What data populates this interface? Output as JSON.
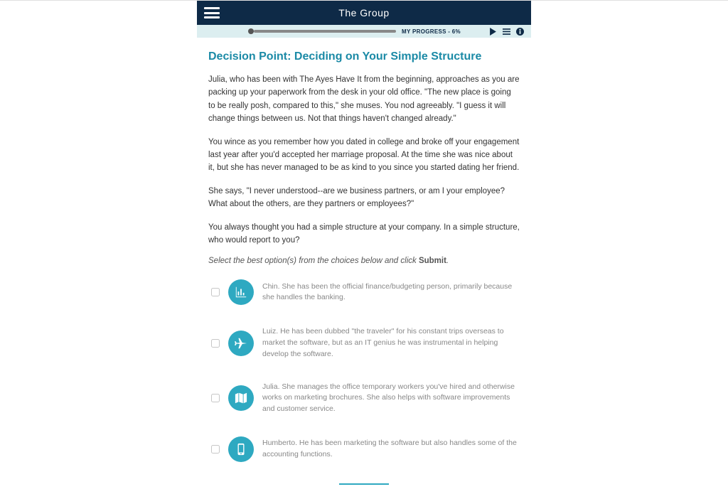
{
  "header": {
    "title": "The Group"
  },
  "progress": {
    "label": "MY PROGRESS - 6%"
  },
  "content": {
    "title": "Decision Point: Deciding on Your Simple Structure",
    "para1": "Julia, who has been with The Ayes Have It from the beginning, approaches as you are packing up your paperwork from the desk in your old office. \"The new place is going to be really posh, compared to this,\" she muses. You nod agreeably. \"I guess it will change things between us. Not that things haven't changed already.\"",
    "para2": "You wince as you remember how you dated in college and broke off your engagement last year after you'd accepted her marriage proposal. At the time she was nice about it, but she has never managed to be as kind to you since you started dating her friend.",
    "para3": "She says, \"I never understood--are we business partners, or am I your employee? What about the others, are they partners or employees?\"",
    "para4": "You always thought you had a simple structure at your company. In a simple structure, who would report to you?",
    "instruction_prefix": "Select the best option(s) from the choices below and click ",
    "instruction_bold": "Submit",
    "instruction_suffix": "."
  },
  "options": [
    {
      "icon": "bar-chart-icon",
      "text": "Chin. She has been the official finance/budgeting person, primarily because she handles the banking."
    },
    {
      "icon": "plane-icon",
      "text": "Luiz. He has been dubbed \"the traveler\" for his constant trips overseas to market the software, but as an IT genius he was instrumental in helping develop the software."
    },
    {
      "icon": "map-icon",
      "text": "Julia. She manages the office temporary workers you've hired and otherwise works on marketing brochures. She also helps with software improvements and customer service."
    },
    {
      "icon": "mobile-icon",
      "text": "Humberto. He has been marketing the software but also handles some of the accounting functions."
    }
  ]
}
